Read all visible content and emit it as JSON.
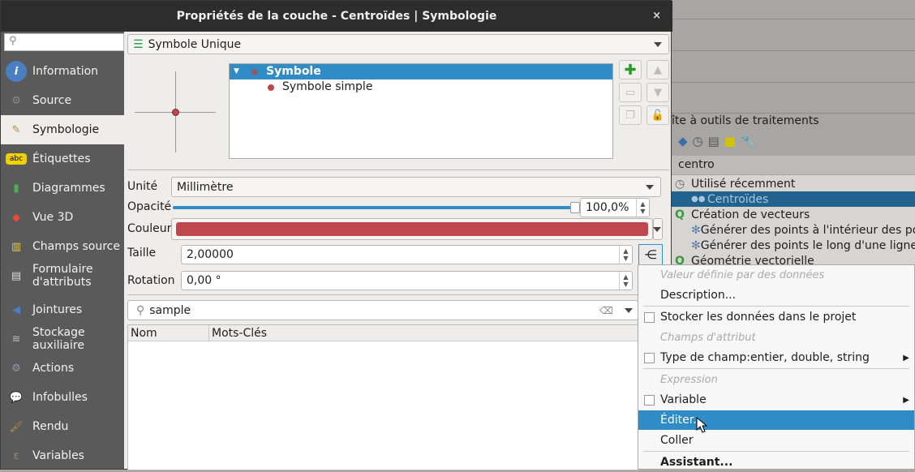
{
  "dialog": {
    "title": "Propriétés de la couche - Centroïdes | Symbologie",
    "close": "×"
  },
  "sidebar": {
    "search_placeholder": "",
    "items": [
      {
        "label": "Information",
        "icon": "info-icon",
        "color": "#4a7fc1"
      },
      {
        "label": "Source",
        "icon": "wrench-gear-icon",
        "color": "#8a8a8a"
      },
      {
        "label": "Symbologie",
        "icon": "paintbrush-icon",
        "color": "#b98a3c"
      },
      {
        "label": "Étiquettes",
        "icon": "abc-label-icon",
        "color": "#f0d000"
      },
      {
        "label": "Diagrammes",
        "icon": "diagram-icon",
        "color": "#4caf50"
      },
      {
        "label": "Vue 3D",
        "icon": "cube-icon",
        "color": "#e84c3d"
      },
      {
        "label": "Champs source",
        "icon": "fields-icon",
        "color": "#e8c840"
      },
      {
        "label": "Formulaire d'attributs",
        "icon": "form-icon",
        "color": "#ddd"
      },
      {
        "label": "Jointures",
        "icon": "join-icon",
        "color": "#4a7fc1"
      },
      {
        "label": "Stockage auxiliaire",
        "icon": "database-icon",
        "color": "#bbb"
      },
      {
        "label": "Actions",
        "icon": "actions-icon",
        "color": "#8a9cb0"
      },
      {
        "label": "Infobulles",
        "icon": "tooltip-icon",
        "color": "#f0d060"
      },
      {
        "label": "Rendu",
        "icon": "brush-icon",
        "color": "#c09050"
      },
      {
        "label": "Variables",
        "icon": "variable-icon",
        "color": "#a08a7a"
      }
    ],
    "selected": "Symbologie"
  },
  "main": {
    "renderer": "Symbole Unique",
    "tree": {
      "root": "Symbole",
      "child": "Symbole simple"
    },
    "unit_label": "Unité",
    "unit": "Millimètre",
    "opacity_label": "Opacité",
    "opacity": "100,0%",
    "opacity_value": 1.0,
    "color_label": "Couleur",
    "color": "#c0474e",
    "size_label": "Taille",
    "size": "2,00000",
    "rotation_label": "Rotation",
    "rotation": "0,00 °",
    "search": "sample",
    "columns": [
      "Nom",
      "Mots-Clés"
    ]
  },
  "menu": {
    "items": [
      {
        "label": "Valeur définie par des données",
        "type": "header"
      },
      {
        "label": "Description...",
        "type": "item"
      },
      {
        "label": "Stocker les données dans le projet",
        "type": "check"
      },
      {
        "label": "Champs d'attribut",
        "type": "header"
      },
      {
        "label": "Type de champ:entier, double, string",
        "type": "check-sub"
      },
      {
        "label": "Expression",
        "type": "header"
      },
      {
        "label": "Variable",
        "type": "check-sub"
      },
      {
        "label": "Éditer...",
        "type": "selected"
      },
      {
        "label": "Coller",
        "type": "item"
      },
      {
        "label": "Assistant...",
        "type": "bold"
      }
    ]
  },
  "toolbox": {
    "title": "îte à outils de traitements",
    "search": "centro",
    "tree": [
      {
        "label": "Utilisé récemment",
        "level": 0,
        "icon": "clock-icon"
      },
      {
        "label": "Centroïdes",
        "level": 1,
        "icon": "algorithm-icon",
        "selected": true
      },
      {
        "label": "Création de vecteurs",
        "level": 0,
        "icon": "qgis-icon"
      },
      {
        "label": "Générer des points à l'intérieur des po",
        "level": 1,
        "icon": "gear-icon"
      },
      {
        "label": "Générer des points le long d'une ligne",
        "level": 1,
        "icon": "gear-icon"
      },
      {
        "label": "Géométrie vectorielle",
        "level": 0,
        "icon": "qgis-icon"
      }
    ]
  }
}
